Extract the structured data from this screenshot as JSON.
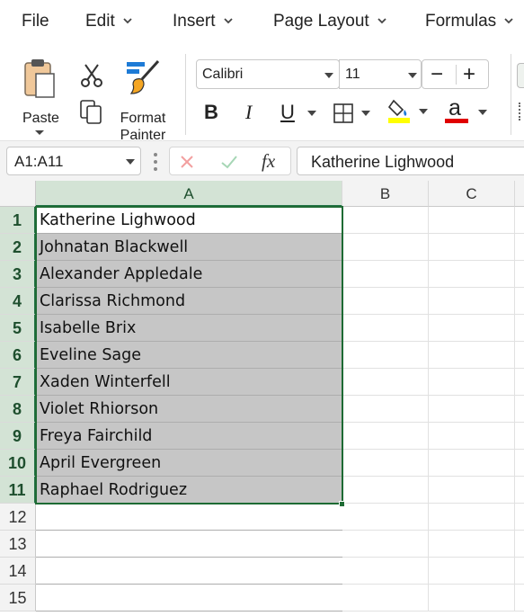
{
  "menu": {
    "items": [
      {
        "label": "File",
        "has_chevron": false
      },
      {
        "label": "Edit",
        "has_chevron": true
      },
      {
        "label": "Insert",
        "has_chevron": true
      },
      {
        "label": "Page Layout",
        "has_chevron": true
      },
      {
        "label": "Formulas",
        "has_chevron": true
      }
    ]
  },
  "ribbon": {
    "paste_label": "Paste",
    "format_painter_label_line1": "Format",
    "format_painter_label_line2": "Painter",
    "font_name": "Calibri",
    "font_size": "11",
    "decrease_size_glyph": "−",
    "increase_size_glyph": "+",
    "bold_glyph": "B",
    "italic_glyph": "I",
    "underline_glyph": "U",
    "font_color_glyph": "a",
    "highlight_color": "#ffff00",
    "font_color": "#e00000"
  },
  "formula_bar": {
    "name_box": "A1:A11",
    "fx_label": "fx",
    "formula_value": "Katherine Lighwood"
  },
  "sheet": {
    "columns": [
      "A",
      "B",
      "C"
    ],
    "selected_column": "A",
    "row_numbers": [
      "1",
      "2",
      "3",
      "4",
      "5",
      "6",
      "7",
      "8",
      "9",
      "10",
      "11",
      "12",
      "13",
      "14",
      "15"
    ],
    "column_a_values": [
      "Katherine Lighwood",
      "Johnatan Blackwell",
      "Alexander Appledale",
      "Clarissa Richmond",
      "Isabelle Brix",
      "Eveline Sage",
      "Xaden Winterfell",
      "Violet Rhiorson",
      "Freya Fairchild",
      "April Evergreen",
      "Raphael Rodriguez"
    ],
    "selection_color": "#1e6b34"
  }
}
